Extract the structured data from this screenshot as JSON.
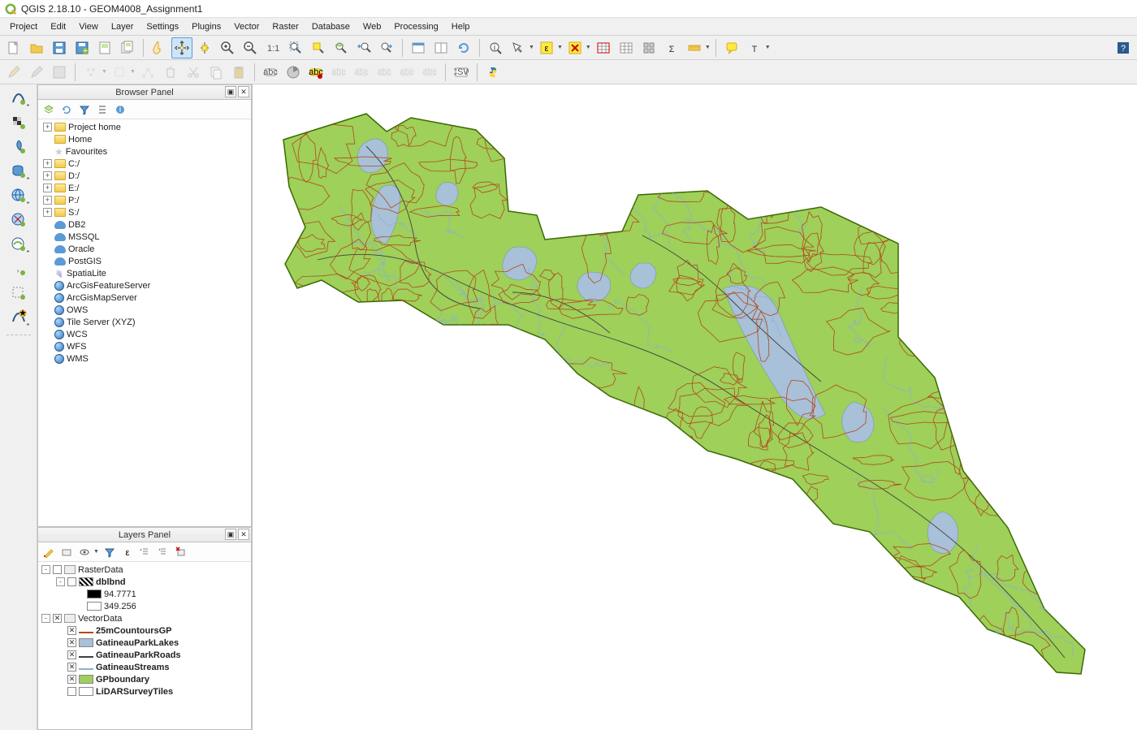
{
  "title": "QGIS 2.18.10 - GEOM4008_Assignment1",
  "menu": [
    "Project",
    "Edit",
    "View",
    "Layer",
    "Settings",
    "Plugins",
    "Vector",
    "Raster",
    "Database",
    "Web",
    "Processing",
    "Help"
  ],
  "browser_panel": {
    "title": "Browser Panel",
    "items": [
      {
        "exp": "+",
        "icon": "folder",
        "label": "Project home"
      },
      {
        "exp": " ",
        "icon": "folder",
        "label": "Home"
      },
      {
        "exp": " ",
        "icon": "star",
        "label": "Favourites"
      },
      {
        "exp": "+",
        "icon": "folder",
        "label": "C:/"
      },
      {
        "exp": "+",
        "icon": "folder",
        "label": "D:/"
      },
      {
        "exp": "+",
        "icon": "folder",
        "label": "E:/"
      },
      {
        "exp": "+",
        "icon": "folder",
        "label": "P:/"
      },
      {
        "exp": "+",
        "icon": "folder",
        "label": "S:/"
      },
      {
        "exp": " ",
        "icon": "db",
        "label": "DB2"
      },
      {
        "exp": " ",
        "icon": "db",
        "label": "MSSQL"
      },
      {
        "exp": " ",
        "icon": "db",
        "label": "Oracle"
      },
      {
        "exp": " ",
        "icon": "db",
        "label": "PostGIS"
      },
      {
        "exp": " ",
        "icon": "feather",
        "label": "SpatiaLite"
      },
      {
        "exp": " ",
        "icon": "globe",
        "label": "ArcGisFeatureServer"
      },
      {
        "exp": " ",
        "icon": "globe",
        "label": "ArcGisMapServer"
      },
      {
        "exp": " ",
        "icon": "globe",
        "label": "OWS"
      },
      {
        "exp": " ",
        "icon": "globe",
        "label": "Tile Server (XYZ)"
      },
      {
        "exp": " ",
        "icon": "globe",
        "label": "WCS"
      },
      {
        "exp": " ",
        "icon": "globe",
        "label": "WFS"
      },
      {
        "exp": " ",
        "icon": "globe",
        "label": "WMS"
      }
    ]
  },
  "layers_panel": {
    "title": "Layers Panel",
    "groups": [
      {
        "name": "RasterData",
        "checked": false,
        "exp": "-",
        "children": [
          {
            "type": "raster",
            "name": "dblbnd",
            "checked": false,
            "exp": "-",
            "values": [
              "94.7771",
              "349.256"
            ]
          }
        ]
      },
      {
        "name": "VectorData",
        "checked": true,
        "exp": "-",
        "children": [
          {
            "type": "vector",
            "name": "25mCountoursGP",
            "checked": true,
            "color": "#b24a1a",
            "geom": "line"
          },
          {
            "type": "vector",
            "name": "GatineauParkLakes",
            "checked": true,
            "color": "#a8c0d8",
            "geom": "poly"
          },
          {
            "type": "vector",
            "name": "GatineauParkRoads",
            "checked": true,
            "color": "#404040",
            "geom": "line"
          },
          {
            "type": "vector",
            "name": "GatineauStreams",
            "checked": true,
            "color": "#8bb0d6",
            "geom": "line"
          },
          {
            "type": "vector",
            "name": "GPboundary",
            "checked": true,
            "color": "#9ed05a",
            "geom": "poly"
          },
          {
            "type": "vector",
            "name": "LiDARSurveyTiles",
            "checked": false,
            "color": "#ffffff",
            "geom": "poly"
          }
        ]
      }
    ]
  },
  "map": {
    "boundary_fill": "#9ed05a",
    "boundary_stroke": "#3a6a00",
    "lake_fill": "#a8c0d8",
    "stream_stroke": "#8bb0d6",
    "road_stroke": "#404040",
    "contour_stroke": "#b24a1a"
  }
}
